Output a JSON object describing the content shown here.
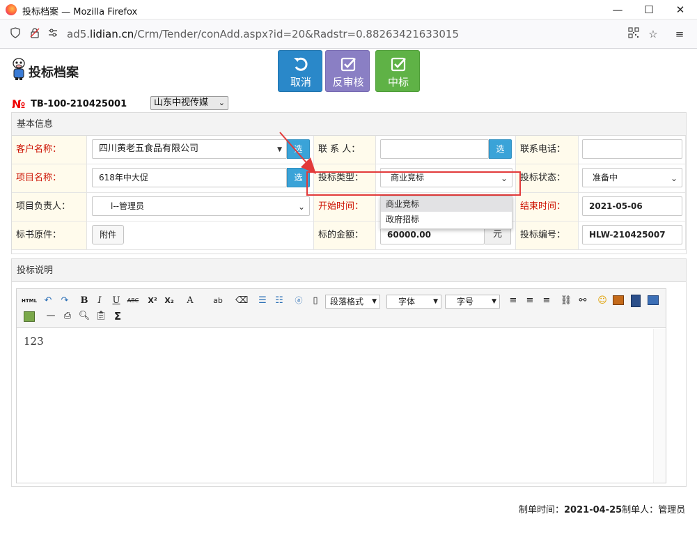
{
  "window": {
    "title": "投标档案 — Mozilla Firefox",
    "minimize": "—",
    "maximize": "☐",
    "close": "✕"
  },
  "browser": {
    "url_host": "ad5.",
    "url_domain": "lidian.cn",
    "url_path": "/Crm/Tender/conAdd.aspx?id=20&Radstr=0.88263421633015"
  },
  "header": {
    "page_title": "投标档案",
    "buttons": {
      "cancel": "取消",
      "unaudit": "反审核",
      "win": "中标"
    },
    "no_sign": "№",
    "code": "TB-100-210425001",
    "company": "山东中视传媒"
  },
  "basic_info": {
    "title": "基本信息",
    "customer_label": "客户名称：",
    "customer_value": "四川黄老五食品有限公司",
    "pick": "选",
    "contact_label": "联 系 人：",
    "contact_value": "",
    "phone_label": "联系电话：",
    "phone_value": "",
    "project_label": "项目名称：",
    "project_value": "618年中大促",
    "type_label": "投标类型：",
    "type_value": "商业竞标",
    "type_options": [
      "商业竞标",
      "政府招标"
    ],
    "status_label": "投标状态：",
    "status_value": "准备中",
    "owner_label": "项目负责人：",
    "owner_value": "l--管理员",
    "start_label": "开始时间：",
    "start_value": "",
    "end_label": "结束时间：",
    "end_value": "2021-05-06",
    "doc_label": "标书原件：",
    "attach_label": "附件",
    "amount_label": "标的金额：",
    "amount_value": "60000.00",
    "amount_unit": "元",
    "bid_no_label": "投标编号：",
    "bid_no_value": "HLW-210425007"
  },
  "description": {
    "title": "投标说明",
    "toolbar": {
      "html": "HTML",
      "para_format": "段落格式",
      "font": "字体",
      "font_size": "字号",
      "bold": "B",
      "italic": "I",
      "underline": "U",
      "strike": "ABC",
      "sup": "X²",
      "sub": "X₂",
      "font_color": "A",
      "sum": "Σ"
    },
    "content": "123"
  },
  "footer": {
    "created_label": "制单时间：",
    "created_value": "2021-04-25",
    "creator_label": "制单人：",
    "creator_value": "管理员"
  },
  "colors": {
    "cancel": "#2a88c9",
    "unaudit": "#8a7fc4",
    "win": "#5fb246",
    "required_label": "#cc1100",
    "highlight": "#e23a3a"
  }
}
